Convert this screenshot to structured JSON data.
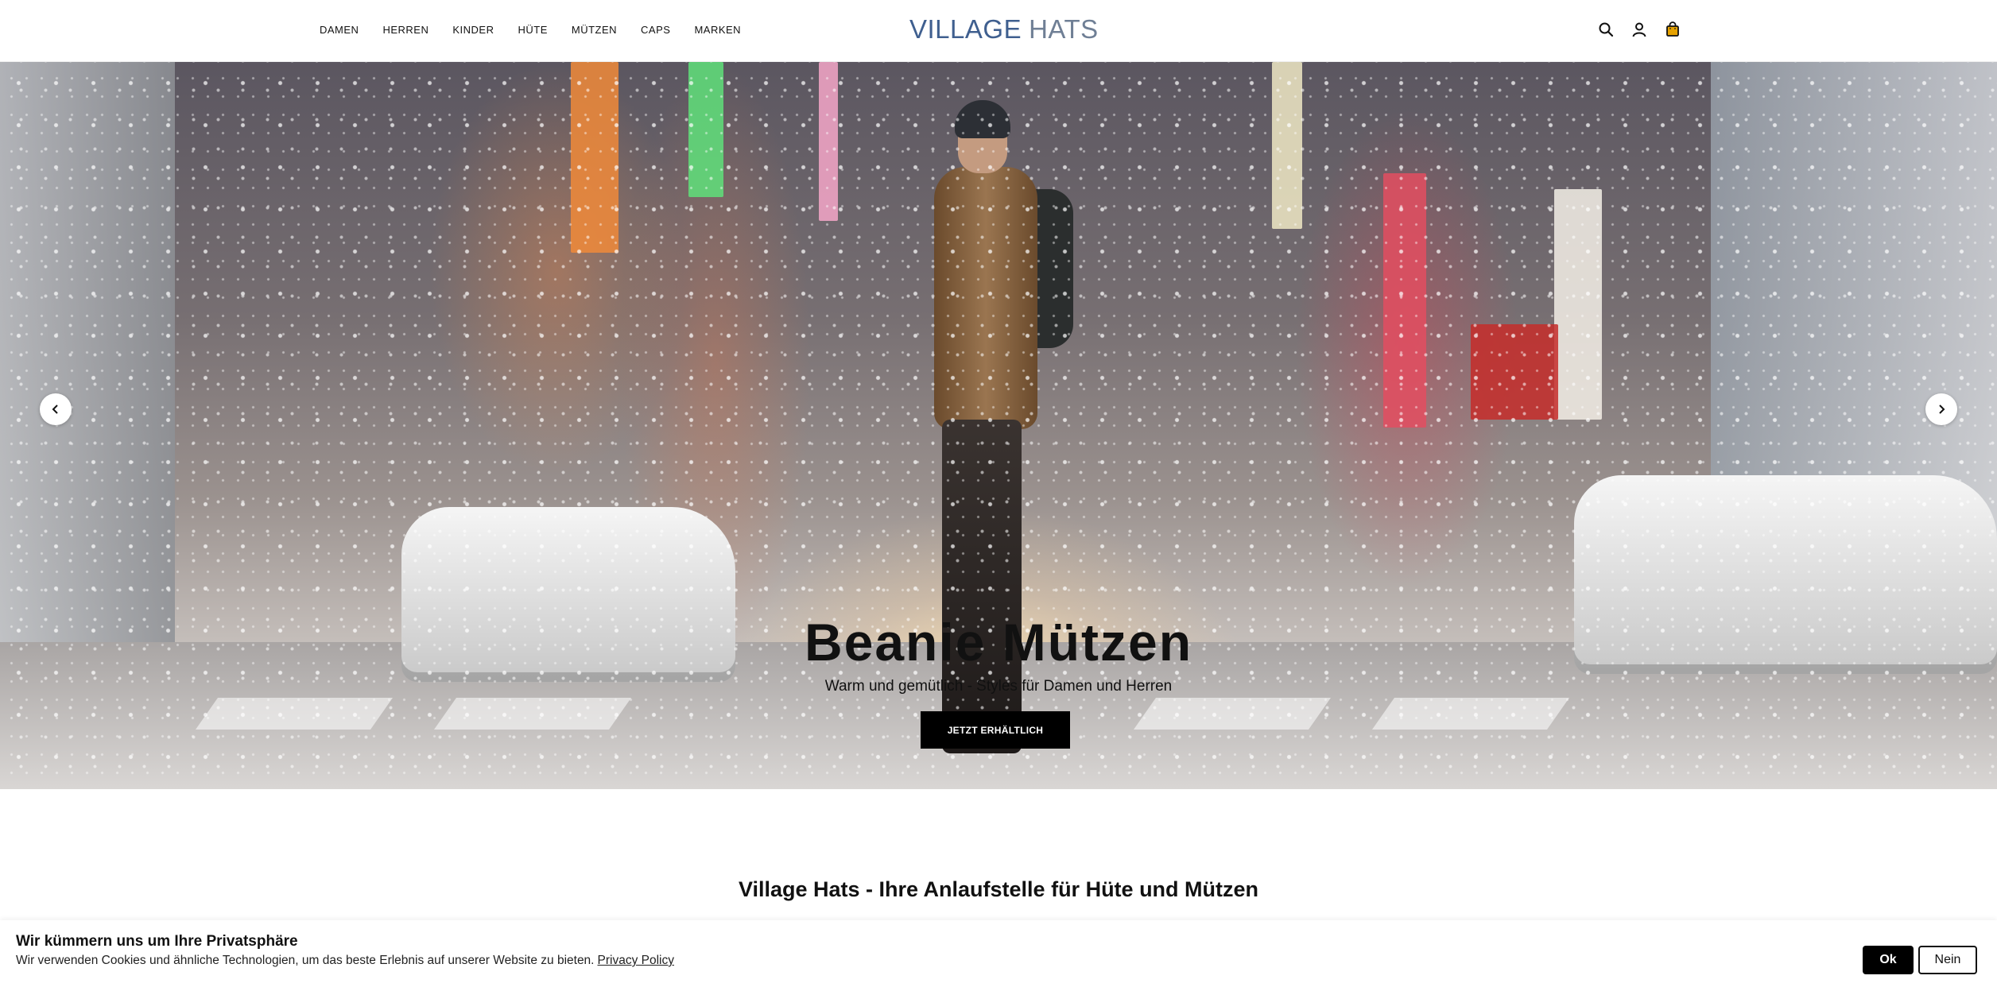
{
  "header": {
    "nav": [
      "DAMEN",
      "HERREN",
      "KINDER",
      "HÜTE",
      "MÜTZEN",
      "CAPS",
      "MARKEN"
    ],
    "logo_part1": "VILLAGE",
    "logo_part2": "HATS",
    "icons": [
      "search-icon",
      "account-icon",
      "cart-icon"
    ],
    "colors": {
      "logo_village": "#3f5f8f",
      "logo_hats": "#6f7f95",
      "cart": "#e6a200"
    }
  },
  "hero": {
    "title": "Beanie Mützen",
    "subtitle": "Warm und gemütlich - Styles für Damen und Herren",
    "cta": "JETZT ERHÄLTLICH",
    "prev_icon": "chevron-left-icon",
    "next_icon": "chevron-right-icon"
  },
  "intro": {
    "heading": "Village Hats - Ihre Anlaufstelle für Hüte und Mützen"
  },
  "cookie": {
    "title": "Wir kümmern uns um Ihre Privatsphäre",
    "text": "Wir verwenden Cookies und ähnliche Technologien, um das beste Erlebnis auf unserer Website zu bieten.",
    "link": "Privacy Policy",
    "ok": "Ok",
    "no": "Nein"
  }
}
